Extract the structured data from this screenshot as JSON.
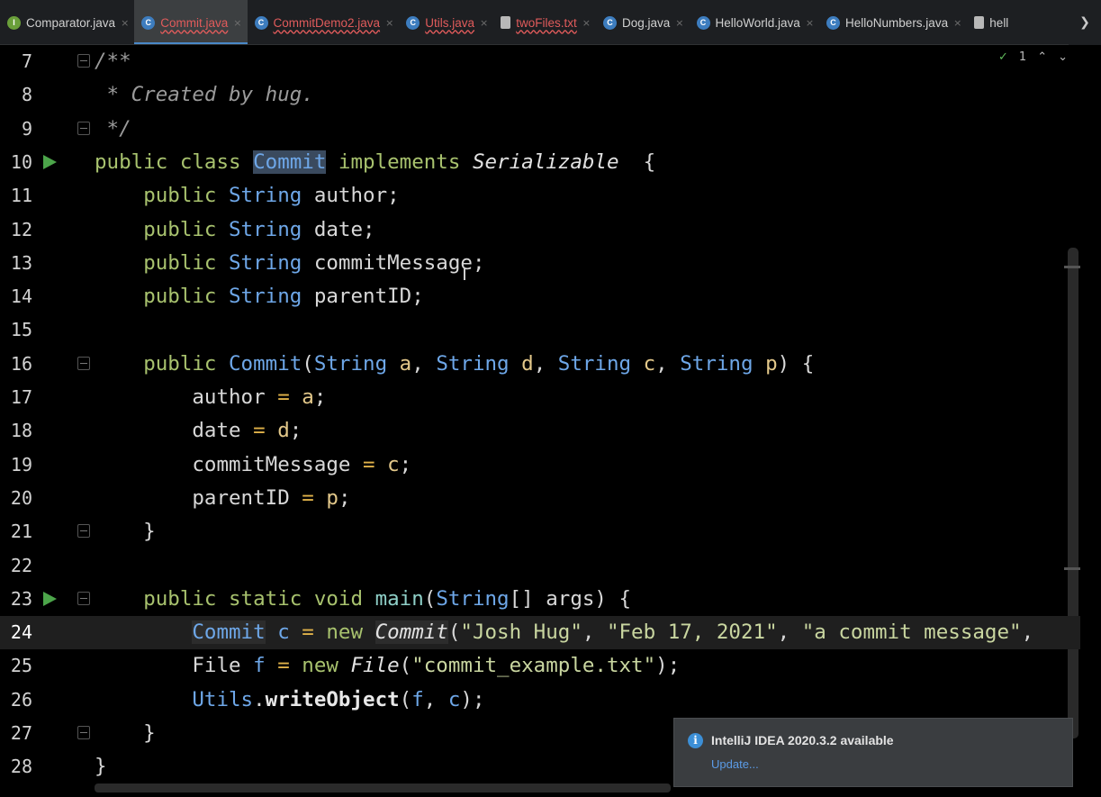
{
  "tabs": [
    {
      "label": "Comparator.java",
      "icon": "interface-icon",
      "style": "plain",
      "active": false,
      "close": "×"
    },
    {
      "label": "Commit.java",
      "icon": "class-icon",
      "style": "err",
      "active": true,
      "close": "×"
    },
    {
      "label": "CommitDemo2.java",
      "icon": "class-icon",
      "style": "err",
      "active": false,
      "close": "×"
    },
    {
      "label": "Utils.java",
      "icon": "class-icon",
      "style": "err",
      "active": false,
      "close": "×"
    },
    {
      "label": "twoFiles.txt",
      "icon": "text-file-icon",
      "style": "err",
      "active": false,
      "close": "×"
    },
    {
      "label": "Dog.java",
      "icon": "class-icon",
      "style": "plain",
      "active": false,
      "close": "×"
    },
    {
      "label": "HelloWorld.java",
      "icon": "class-icon",
      "style": "plain",
      "active": false,
      "close": "×"
    },
    {
      "label": "HelloNumbers.java",
      "icon": "class-icon",
      "style": "plain",
      "active": false,
      "close": "×"
    },
    {
      "label": "hell",
      "icon": "text-file-icon",
      "style": "plain",
      "active": false,
      "close": ""
    }
  ],
  "tab_overflow": "❯",
  "inspections": {
    "count": "1",
    "up": "⌃",
    "down": "⌄"
  },
  "lines": [
    {
      "n": "7",
      "tokens": [
        [
          "cm",
          "/**"
        ]
      ],
      "fold": true
    },
    {
      "n": "8",
      "tokens": [
        [
          "cm",
          " * Created by hug."
        ]
      ]
    },
    {
      "n": "9",
      "tokens": [
        [
          "cm",
          " */"
        ]
      ],
      "fold": true
    },
    {
      "n": "10",
      "run": true,
      "tokens": [
        [
          "kw",
          "public class "
        ],
        [
          "hl",
          "Commit"
        ],
        [
          "kw",
          " implements "
        ],
        [
          "it",
          "Serializable"
        ],
        [
          "",
          "  {"
        ]
      ]
    },
    {
      "n": "11",
      "tokens": [
        [
          "",
          "    "
        ],
        [
          "kw",
          "public "
        ],
        [
          "ty",
          "String"
        ],
        [
          "",
          " author;"
        ]
      ]
    },
    {
      "n": "12",
      "tokens": [
        [
          "",
          "    "
        ],
        [
          "kw",
          "public "
        ],
        [
          "ty",
          "String"
        ],
        [
          "",
          " date;"
        ]
      ]
    },
    {
      "n": "13",
      "tokens": [
        [
          "",
          "    "
        ],
        [
          "kw",
          "public "
        ],
        [
          "ty",
          "String"
        ],
        [
          "",
          " commitMessage;"
        ]
      ]
    },
    {
      "n": "14",
      "tokens": [
        [
          "",
          "    "
        ],
        [
          "kw",
          "public "
        ],
        [
          "ty",
          "String"
        ],
        [
          "",
          " parentID;"
        ]
      ]
    },
    {
      "n": "15",
      "tokens": []
    },
    {
      "n": "16",
      "fold": true,
      "tokens": [
        [
          "",
          "    "
        ],
        [
          "kw",
          "public "
        ],
        [
          "ty",
          "Commit"
        ],
        [
          "",
          "("
        ],
        [
          "ty",
          "String"
        ],
        [
          "pm",
          " a"
        ],
        [
          "",
          ", "
        ],
        [
          "ty",
          "String"
        ],
        [
          "pm",
          " d"
        ],
        [
          "",
          ", "
        ],
        [
          "ty",
          "String"
        ],
        [
          "pm",
          " c"
        ],
        [
          "",
          ", "
        ],
        [
          "ty",
          "String"
        ],
        [
          "pm",
          " p"
        ],
        [
          "",
          ") {"
        ]
      ]
    },
    {
      "n": "17",
      "tokens": [
        [
          "",
          "        author "
        ],
        [
          "op",
          "="
        ],
        [
          "pm",
          " a"
        ],
        [
          "",
          ";"
        ]
      ]
    },
    {
      "n": "18",
      "tokens": [
        [
          "",
          "        date "
        ],
        [
          "op",
          "="
        ],
        [
          "pm",
          " d"
        ],
        [
          "",
          ";"
        ]
      ]
    },
    {
      "n": "19",
      "tokens": [
        [
          "",
          "        commitMessage "
        ],
        [
          "op",
          "="
        ],
        [
          "pm",
          " c"
        ],
        [
          "",
          ";"
        ]
      ]
    },
    {
      "n": "20",
      "tokens": [
        [
          "",
          "        parentID "
        ],
        [
          "op",
          "="
        ],
        [
          "pm",
          " p"
        ],
        [
          "",
          ";"
        ]
      ]
    },
    {
      "n": "21",
      "fold": true,
      "tokens": [
        [
          "",
          "    }"
        ]
      ]
    },
    {
      "n": "22",
      "tokens": []
    },
    {
      "n": "23",
      "run": true,
      "fold": true,
      "tokens": [
        [
          "",
          "    "
        ],
        [
          "kw",
          "public static void "
        ],
        [
          "fn",
          "main"
        ],
        [
          "",
          "("
        ],
        [
          "ty",
          "String"
        ],
        [
          "",
          "[] args) {"
        ]
      ]
    },
    {
      "n": "24",
      "current": true,
      "tokens": [
        [
          "",
          "        "
        ],
        [
          "hl2",
          "Commit"
        ],
        [
          "ty",
          " c"
        ],
        [
          "op",
          " ="
        ],
        [
          "kw",
          " new "
        ],
        [
          "hl2i",
          "Commit"
        ],
        [
          "",
          "("
        ],
        [
          "str",
          "\"Josh Hug\""
        ],
        [
          "",
          ", "
        ],
        [
          "str",
          "\"Feb 17, 2021\""
        ],
        [
          "",
          ", "
        ],
        [
          "str",
          "\"a commit message\""
        ],
        [
          "",
          ","
        ]
      ]
    },
    {
      "n": "25",
      "tokens": [
        [
          "",
          "        File "
        ],
        [
          "ty",
          "f"
        ],
        [
          "op",
          " ="
        ],
        [
          "kw",
          " new "
        ],
        [
          "it",
          "File"
        ],
        [
          "",
          "("
        ],
        [
          "str",
          "\"commit_example.txt\""
        ],
        [
          "",
          ");"
        ]
      ]
    },
    {
      "n": "26",
      "tokens": [
        [
          "",
          "        "
        ],
        [
          "ty",
          "Utils"
        ],
        [
          "",
          "."
        ],
        [
          "bo",
          "writeObject"
        ],
        [
          "",
          "("
        ],
        [
          "ty",
          "f"
        ],
        [
          "",
          ", "
        ],
        [
          "ty",
          "c"
        ],
        [
          "",
          ");"
        ]
      ]
    },
    {
      "n": "27",
      "fold": true,
      "tokens": [
        [
          "",
          "    }"
        ]
      ]
    },
    {
      "n": "28",
      "tokens": [
        [
          "",
          "}"
        ]
      ]
    }
  ],
  "notification": {
    "title": "IntelliJ IDEA 2020.3.2 available",
    "link": "Update...",
    "icon": "info-icon"
  },
  "colors": {
    "accent": "#4a88c7",
    "run": "#4ca54a",
    "link": "#5b9be6"
  }
}
